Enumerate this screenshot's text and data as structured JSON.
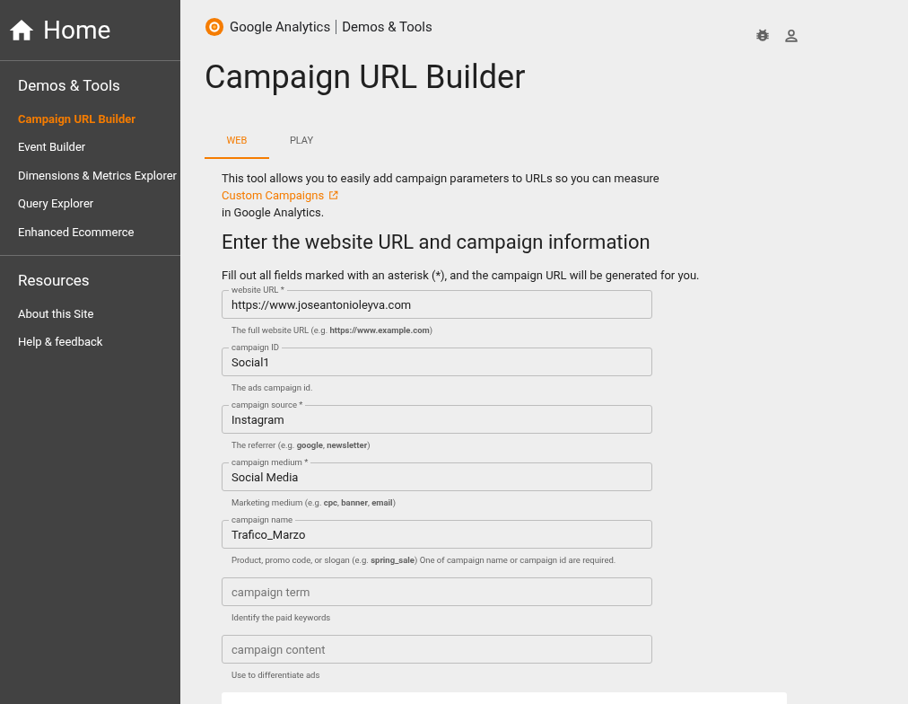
{
  "sidebar": {
    "home": "Home",
    "sections": [
      {
        "title": "Demos & Tools",
        "items": [
          {
            "label": "Campaign URL Builder",
            "selected": true
          },
          {
            "label": "Event Builder",
            "selected": false
          },
          {
            "label": "Dimensions & Metrics Explorer",
            "selected": false
          },
          {
            "label": "Query Explorer",
            "selected": false
          },
          {
            "label": "Enhanced Ecommerce",
            "selected": false
          }
        ]
      },
      {
        "title": "Resources",
        "items": [
          {
            "label": "About this Site",
            "selected": false
          },
          {
            "label": "Help & feedback",
            "selected": false
          }
        ]
      }
    ]
  },
  "header": {
    "brand": "Google Analytics",
    "product": "Demos & Tools"
  },
  "title": "Campaign URL Builder",
  "tabs": [
    {
      "label": "WEB",
      "selected": true
    },
    {
      "label": "PLAY",
      "selected": false
    }
  ],
  "intro": {
    "before": "This tool allows you to easily add campaign parameters to URLs so you can measure",
    "link": "Custom Campaigns",
    "after": "in Google Analytics."
  },
  "section_title": "Enter the website URL and campaign information",
  "instructions": "Fill out all fields marked with an asterisk (*), and the campaign URL will be generated for you.",
  "fields": [
    {
      "label": "website URL *",
      "value": "https://www.joseantonioleyva.com",
      "helper": "The full website URL (e.g. **https://www.example.com**)"
    },
    {
      "label": "campaign ID",
      "value": "Social1",
      "helper": "The ads campaign id."
    },
    {
      "label": "campaign source *",
      "value": "Instagram",
      "helper": "The referrer (e.g. **google**, **newsletter**)"
    },
    {
      "label": "campaign medium *",
      "value": "Social Media",
      "helper": "Marketing medium (e.g. **cpc**, **banner**, **email**)"
    },
    {
      "label": "campaign name",
      "value": "Trafico_Marzo",
      "helper": "Product, promo code, or slogan (e.g. **spring_sale**) One of campaign name or campaign id are required."
    },
    {
      "placeholder": "campaign term",
      "helper": "Identify the paid keywords"
    },
    {
      "placeholder": "campaign content",
      "helper": "Use to differentiate ads"
    }
  ]
}
